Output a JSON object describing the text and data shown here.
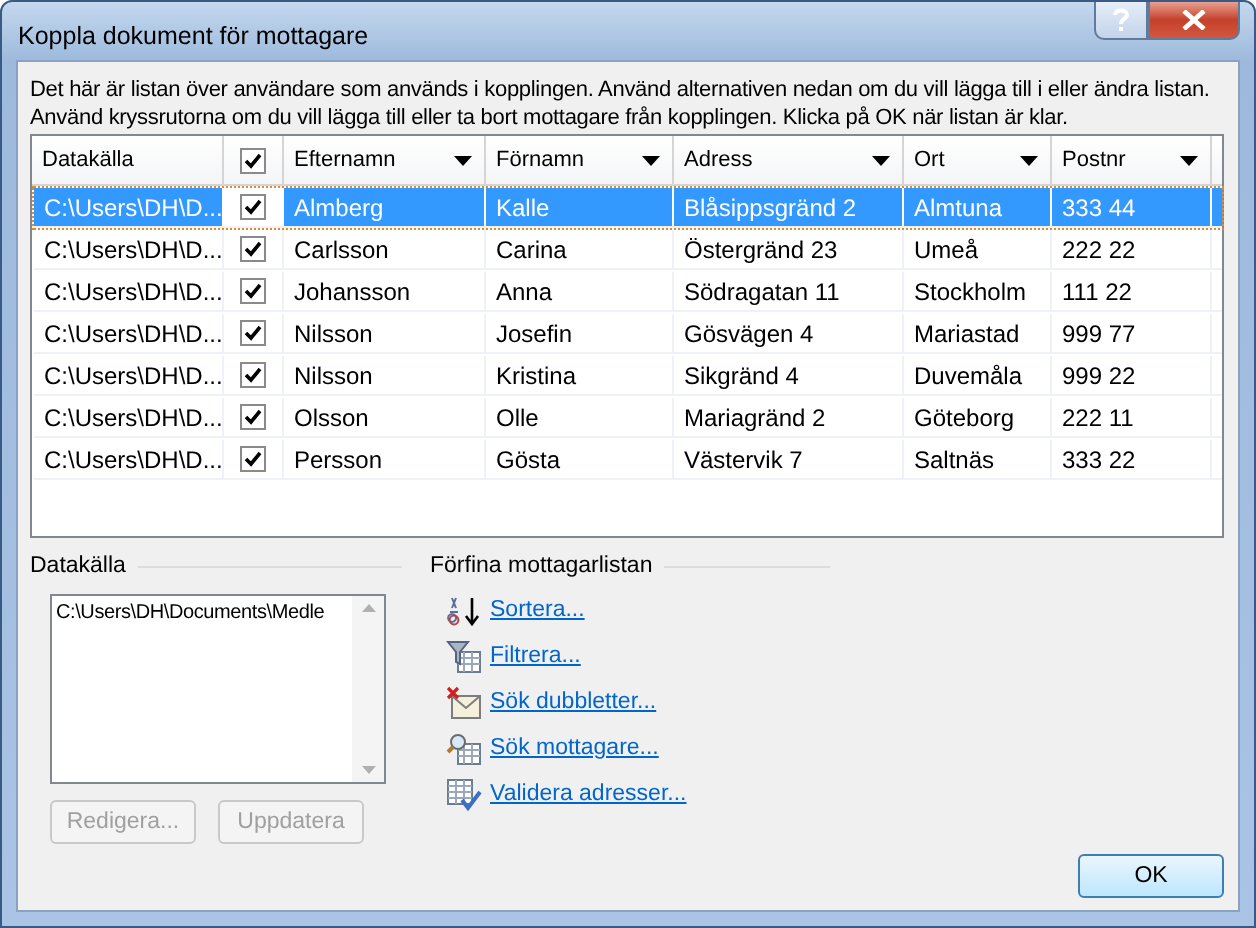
{
  "window": {
    "title": "Koppla dokument för mottagare"
  },
  "intro": [
    "Det här är listan över användare som används i kopplingen. Använd alternativen nedan om du vill lägga till i eller ändra listan.",
    "Använd kryssrutorna om du vill lägga till eller ta bort mottagare från kopplingen. Klicka på OK när listan är klar."
  ],
  "table": {
    "check_column": {
      "checked": true
    },
    "columns": [
      {
        "label": "Datakälla",
        "dropdown": false
      },
      {
        "label": "Efternamn",
        "dropdown": true
      },
      {
        "label": "Förnamn",
        "dropdown": true
      },
      {
        "label": "Adress",
        "dropdown": true
      },
      {
        "label": "Ort",
        "dropdown": true
      },
      {
        "label": "Postnr",
        "dropdown": true
      }
    ],
    "rows": [
      {
        "selected": true,
        "checked": true,
        "cells": [
          "C:\\Users\\DH\\D...",
          "Almberg",
          "Kalle",
          "Blåsippsgränd 2",
          "Almtuna",
          "333 44"
        ]
      },
      {
        "selected": false,
        "checked": true,
        "cells": [
          "C:\\Users\\DH\\D...",
          "Carlsson",
          "Carina",
          "Östergränd 23",
          "Umeå",
          "222 22"
        ]
      },
      {
        "selected": false,
        "checked": true,
        "cells": [
          "C:\\Users\\DH\\D...",
          "Johansson",
          "Anna",
          "Södragatan 11",
          "Stockholm",
          "111 22"
        ]
      },
      {
        "selected": false,
        "checked": true,
        "cells": [
          "C:\\Users\\DH\\D...",
          "Nilsson",
          "Josefin",
          "Gösvägen 4",
          "Mariastad",
          "999 77"
        ]
      },
      {
        "selected": false,
        "checked": true,
        "cells": [
          "C:\\Users\\DH\\D...",
          "Nilsson",
          "Kristina",
          "Sikgränd 4",
          "Duvemåla",
          "999 22"
        ]
      },
      {
        "selected": false,
        "checked": true,
        "cells": [
          "C:\\Users\\DH\\D...",
          "Olsson",
          "Olle",
          "Mariagränd 2",
          "Göteborg",
          "222 11"
        ]
      },
      {
        "selected": false,
        "checked": true,
        "cells": [
          "C:\\Users\\DH\\D...",
          "Persson",
          "Gösta",
          "Västervik 7",
          "Saltnäs",
          "333 22"
        ]
      }
    ]
  },
  "data_source": {
    "label": "Datakälla",
    "items": [
      "C:\\Users\\DH\\Documents\\Medle"
    ],
    "buttons": [
      {
        "label": "Redigera...",
        "disabled": true
      },
      {
        "label": "Uppdatera",
        "disabled": true
      }
    ]
  },
  "refine": {
    "label": "Förfina mottagarlistan",
    "links": [
      {
        "kind": "sort",
        "label": "Sortera..."
      },
      {
        "kind": "filter",
        "label": "Filtrera..."
      },
      {
        "kind": "duplicates",
        "label": "Sök dubbletter..."
      },
      {
        "kind": "find",
        "label": "Sök mottagare..."
      },
      {
        "kind": "validate",
        "label": "Validera adresser..."
      }
    ]
  },
  "ok_button": {
    "label": "OK"
  }
}
